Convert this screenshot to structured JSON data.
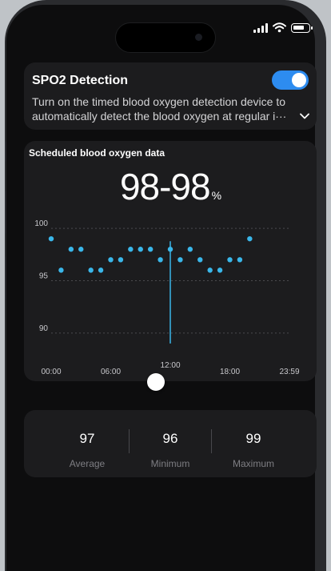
{
  "status_bar": {
    "icons": [
      "cellular-signal-icon",
      "wifi-icon",
      "battery-icon"
    ]
  },
  "spo2": {
    "title": "SPO2 Detection",
    "description": "Turn on the timed blood oxygen detection device to automatically detect the blood oxygen at regular i···",
    "toggle_on": true,
    "accent": "#2d8cf0"
  },
  "chart_data": {
    "type": "scatter",
    "title": "Scheduled blood oxygen data",
    "headline_value": "98-98",
    "headline_unit": "%",
    "x_ticks": [
      "00:00",
      "06:00",
      "12:00",
      "18:00",
      "23:59"
    ],
    "y_ticks": [
      "100",
      "95",
      "90"
    ],
    "ylim": [
      88,
      101
    ],
    "xlim": [
      0,
      24
    ],
    "grid": true,
    "point_color": "#3ab7ea",
    "selected_time": "12:00",
    "selected_x": 12,
    "points": [
      {
        "x": 0.0,
        "y": 99
      },
      {
        "x": 1.0,
        "y": 96
      },
      {
        "x": 2.0,
        "y": 98
      },
      {
        "x": 3.0,
        "y": 98
      },
      {
        "x": 4.0,
        "y": 96
      },
      {
        "x": 5.0,
        "y": 96
      },
      {
        "x": 6.0,
        "y": 97
      },
      {
        "x": 7.0,
        "y": 97
      },
      {
        "x": 8.0,
        "y": 98
      },
      {
        "x": 9.0,
        "y": 98
      },
      {
        "x": 10.0,
        "y": 98
      },
      {
        "x": 11.0,
        "y": 97
      },
      {
        "x": 12.0,
        "y": 98
      },
      {
        "x": 13.0,
        "y": 97
      },
      {
        "x": 14.0,
        "y": 98
      },
      {
        "x": 15.0,
        "y": 97
      },
      {
        "x": 16.0,
        "y": 96
      },
      {
        "x": 17.0,
        "y": 96
      },
      {
        "x": 18.0,
        "y": 97
      },
      {
        "x": 19.0,
        "y": 97
      },
      {
        "x": 20.0,
        "y": 99
      }
    ]
  },
  "stats": [
    {
      "value": "97",
      "label": "Average"
    },
    {
      "value": "96",
      "label": "Minimum"
    },
    {
      "value": "99",
      "label": "Maximum"
    }
  ]
}
